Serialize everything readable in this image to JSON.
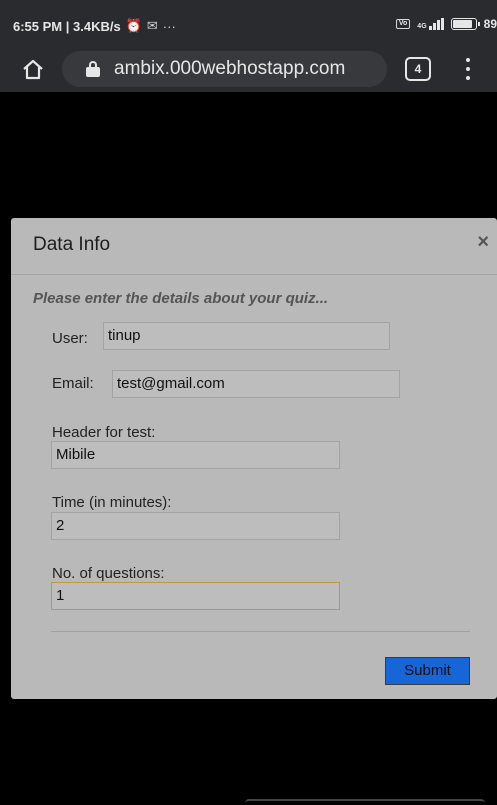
{
  "status_bar": {
    "time_speed": "6:55 PM | 3.4KB/s",
    "alarm_icon": "alarm-clock-icon",
    "mail_icon": "gmail-icon",
    "more_dots": "···",
    "vo_label": "VoLTE",
    "network_label": "4G",
    "battery": "89",
    "battery_level": 0.89
  },
  "browser": {
    "url": "ambix.000webhostapp.com",
    "tab_count": "4"
  },
  "modal": {
    "title": "Data Info",
    "close": "×",
    "intro": "Please enter the details about your quiz...",
    "fields": {
      "user": {
        "label": "User:",
        "value": "tinup"
      },
      "email": {
        "label": "Email:",
        "value": "test@gmail.com"
      },
      "header": {
        "label": "Header for test:",
        "value": "Mibile"
      },
      "time": {
        "label": "Time (in minutes):",
        "value": "2"
      },
      "questions": {
        "label": "No. of questions:",
        "value": "1"
      }
    },
    "submit_label": "Submit"
  },
  "colors": {
    "chrome_bar": "#2a2b2e",
    "modal_bg": "#b9b9b9",
    "submit": "#1666d8",
    "focus_border": "#c49a2c"
  }
}
